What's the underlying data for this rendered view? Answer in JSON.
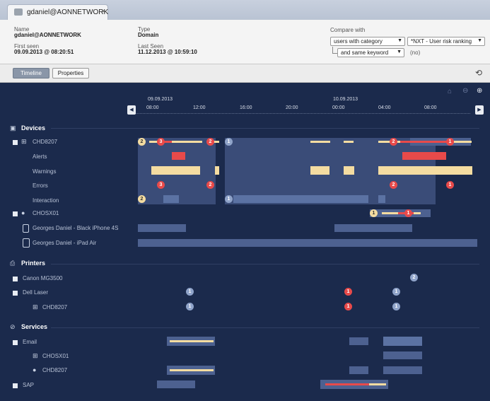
{
  "tab": {
    "title": "gdaniel@AONNETWORK",
    "close": "×"
  },
  "info": {
    "name_label": "Name",
    "name_value": "gdaniel@AONNETWORK",
    "type_label": "Type",
    "type_value": "Domain",
    "first_seen_label": "First seen",
    "first_seen_value": "09.09.2013 @ 08:20:51",
    "last_seen_label": "Last Seen",
    "last_seen_value": "11.12.2013 @ 10:59:10",
    "compare_label": "Compare with",
    "compare_select": "users with category",
    "ranking_select": "*NXT - User risk ranking",
    "keyword_select": "and same keyword",
    "keyword_note": "(no)"
  },
  "toolbar": {
    "timeline": "Timeline",
    "properties": "Properties"
  },
  "timeline": {
    "dates": [
      "09.09.2013",
      "10.09.2013"
    ],
    "ticks": [
      "08:00",
      "12:00",
      "16:00",
      "20:00",
      "00:00",
      "04:00",
      "08:00"
    ]
  },
  "sections": {
    "devices": "Devices",
    "printers": "Printers",
    "services": "Services"
  },
  "rows": {
    "chd8207": "CHD8207",
    "alerts": "Alerts",
    "warnings": "Warnings",
    "errors": "Errors",
    "interaction": "Interaction",
    "chosx01": "CHOSX01",
    "iphone": "Georges Daniel - Black iPhone 4S",
    "ipad": "Georges Daniel - iPad Air",
    "canon": "Canon MG3500",
    "dell": "Dell Laser",
    "dell_chd": "CHD8207",
    "email": "Email",
    "email_chosx": "CHOSX01",
    "email_chd": "CHD8207",
    "sap": "SAP"
  },
  "badges": {
    "b2": "2",
    "b3": "3",
    "b1": "1"
  },
  "colors": {
    "bg": "#1b2a4c",
    "warning": "#f4dca1",
    "alert": "#e84a4a",
    "bar": "#4d6190"
  }
}
